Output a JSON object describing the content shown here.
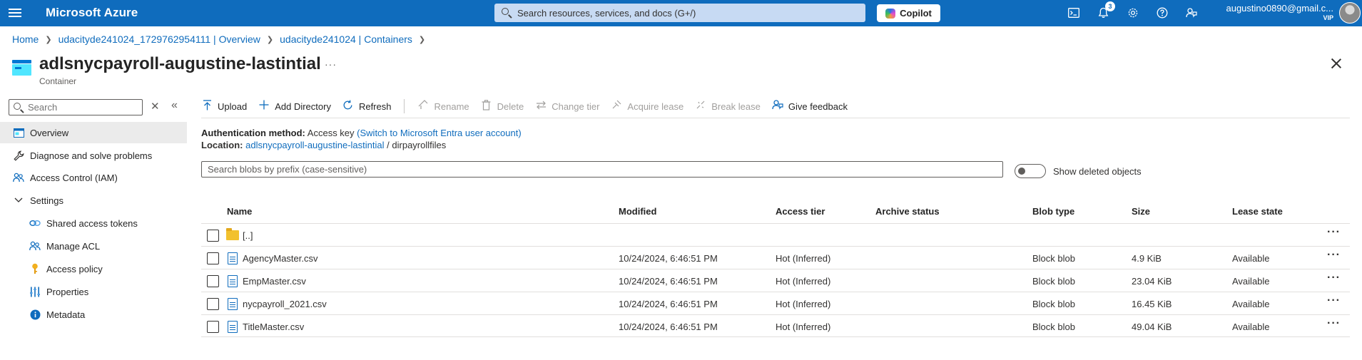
{
  "topbar": {
    "brand": "Microsoft Azure",
    "search_placeholder": "Search resources, services, and docs (G+/)",
    "copilot_label": "Copilot",
    "notifications_count": "3",
    "account_email": "augustino0890@gmail.c...",
    "account_tag": "VIP"
  },
  "breadcrumb": {
    "items": [
      "Home",
      "udacityde241024_1729762954111 | Overview",
      "udacityde241024 | Containers"
    ]
  },
  "header": {
    "title": "adlsnycpayroll-augustine-lastintial",
    "more": "···",
    "subtitle": "Container"
  },
  "sidebar": {
    "search_placeholder": "Search",
    "items": [
      {
        "label": "Overview",
        "icon": "overview-icon"
      },
      {
        "label": "Diagnose and solve problems",
        "icon": "wrench-icon"
      },
      {
        "label": "Access Control (IAM)",
        "icon": "people-icon"
      },
      {
        "label": "Settings",
        "icon": "chevron-down-icon"
      },
      {
        "label": "Shared access tokens",
        "icon": "link-icon"
      },
      {
        "label": "Manage ACL",
        "icon": "people-icon"
      },
      {
        "label": "Access policy",
        "icon": "key-icon"
      },
      {
        "label": "Properties",
        "icon": "properties-icon"
      },
      {
        "label": "Metadata",
        "icon": "info-icon"
      }
    ]
  },
  "toolbar": {
    "upload": "Upload",
    "add_directory": "Add Directory",
    "refresh": "Refresh",
    "rename": "Rename",
    "delete": "Delete",
    "change_tier": "Change tier",
    "acquire_lease": "Acquire lease",
    "break_lease": "Break lease",
    "give_feedback": "Give feedback"
  },
  "auth": {
    "label": "Authentication method:",
    "value": "Access key",
    "switch_link": "(Switch to Microsoft Entra user account)"
  },
  "location": {
    "label": "Location:",
    "container_link": "adlsnycpayroll-augustine-lastintial",
    "separator": "/",
    "folder": "dirpayrollfiles"
  },
  "blob_search": {
    "placeholder": "Search blobs by prefix (case-sensitive)"
  },
  "show_deleted": {
    "label": "Show deleted objects",
    "enabled": false
  },
  "table": {
    "columns": [
      "Name",
      "Modified",
      "Access tier",
      "Archive status",
      "Blob type",
      "Size",
      "Lease state"
    ],
    "parent_row": "[..]",
    "rows": [
      {
        "name": "AgencyMaster.csv",
        "modified": "10/24/2024, 6:46:51 PM",
        "tier": "Hot (Inferred)",
        "archive": "",
        "type": "Block blob",
        "size": "4.9 KiB",
        "lease": "Available"
      },
      {
        "name": "EmpMaster.csv",
        "modified": "10/24/2024, 6:46:51 PM",
        "tier": "Hot (Inferred)",
        "archive": "",
        "type": "Block blob",
        "size": "23.04 KiB",
        "lease": "Available"
      },
      {
        "name": "nycpayroll_2021.csv",
        "modified": "10/24/2024, 6:46:51 PM",
        "tier": "Hot (Inferred)",
        "archive": "",
        "type": "Block blob",
        "size": "16.45 KiB",
        "lease": "Available"
      },
      {
        "name": "TitleMaster.csv",
        "modified": "10/24/2024, 6:46:51 PM",
        "tier": "Hot (Inferred)",
        "archive": "",
        "type": "Block blob",
        "size": "49.04 KiB",
        "lease": "Available"
      }
    ],
    "more": "···"
  },
  "colors": {
    "brand_blue": "#0f6cbd",
    "topbar_search_bg": "#c7daf3",
    "folder_yellow": "#f2c12e"
  }
}
